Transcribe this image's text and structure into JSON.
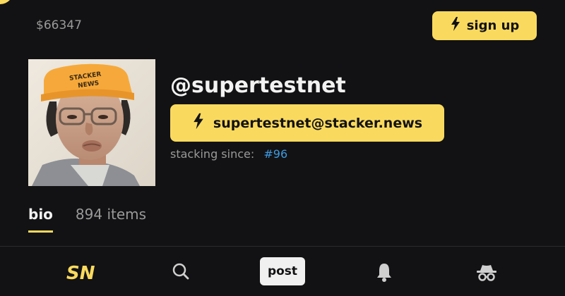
{
  "header": {
    "price": "$66347",
    "signup_label": "sign up"
  },
  "profile": {
    "username": "@supertestnet",
    "lightning_address": "supertestnet@stacker.news",
    "stacking_since_label": "stacking since:",
    "stacking_since_value": "#96",
    "avatar_hat_text": "STACKER NEWS"
  },
  "tabs": [
    {
      "label": "bio",
      "active": true
    },
    {
      "label": "894 items",
      "active": false
    }
  ],
  "bottom_nav": {
    "logo": "SN",
    "post_label": "post",
    "icons": [
      "logo-icon",
      "search-icon",
      "bell-icon",
      "incognito-icon"
    ]
  },
  "colors": {
    "accent": "#fada5e",
    "background": "#121214",
    "link": "#3d9ae0"
  }
}
